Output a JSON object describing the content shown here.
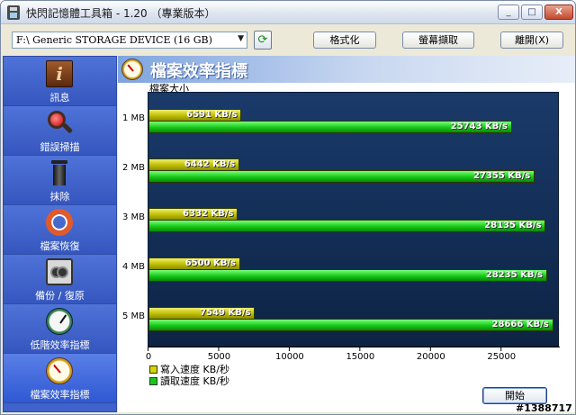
{
  "window": {
    "title": "快閃記憶體工具箱 - 1.20 （專業版本）",
    "buttons": {
      "minimize": "_",
      "maximize": "□",
      "close": "X"
    }
  },
  "toolbar": {
    "device": "F:\\ Generic STORAGE DEVICE (16 GB)",
    "refresh_icon": "refresh-icon",
    "format_label": "格式化",
    "capture_label": "螢幕擷取",
    "exit_label": "離開(X)"
  },
  "sidebar": {
    "items": [
      {
        "label": "訊息",
        "icon": "info-icon"
      },
      {
        "label": "錯誤掃描",
        "icon": "magnifier-icon"
      },
      {
        "label": "抹除",
        "icon": "trash-icon"
      },
      {
        "label": "檔案恢復",
        "icon": "lifebuoy-icon"
      },
      {
        "label": "備份 / 復原",
        "icon": "tape-icon"
      },
      {
        "label": "低階效率指標",
        "icon": "stopwatch-icon"
      },
      {
        "label": "檔案效率指標",
        "icon": "stopwatch-icon",
        "active": true
      }
    ]
  },
  "content": {
    "title": "檔案效率指標",
    "size_caption": "檔案大小",
    "start_label": "開始"
  },
  "chart_data": {
    "type": "bar",
    "orientation": "horizontal",
    "categories": [
      "1 MB",
      "2 MB",
      "3 MB",
      "4 MB",
      "5 MB"
    ],
    "series": [
      {
        "name": "寫入速度 KB/秒",
        "values": [
          6591,
          6442,
          6332,
          6500,
          7549
        ],
        "labels": [
          "6591 KB/s",
          "6442 KB/s",
          "6332 KB/s",
          "6500 KB/s",
          "7549 KB/s"
        ],
        "color": "#d4d400"
      },
      {
        "name": "讀取速度 KB/秒",
        "values": [
          25743,
          27355,
          28135,
          28235,
          28666
        ],
        "labels": [
          "25743 KB/s",
          "27355 KB/s",
          "28135 KB/s",
          "28235 KB/s",
          "28666 KB/s"
        ],
        "color": "#18c818"
      }
    ],
    "x_ticks": [
      "0",
      "5000",
      "10000",
      "15000",
      "20000",
      "25000"
    ],
    "xlim": [
      0,
      29000
    ],
    "colors": {
      "plot_bg": "#1a3a6a"
    }
  },
  "watermark": "#1388717"
}
